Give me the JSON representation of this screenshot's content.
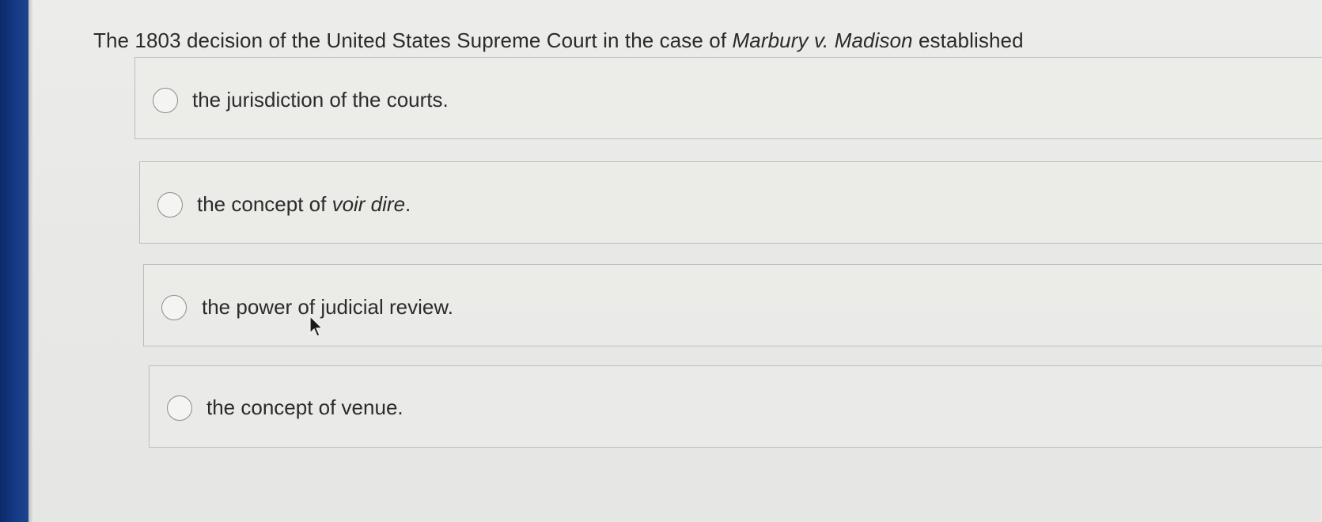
{
  "question": {
    "prefix": "The 1803 decision of the United States Supreme Court in the case of ",
    "case_name": "Marbury v. Madison",
    "suffix": " established"
  },
  "options": [
    {
      "text": "the jurisdiction of the courts."
    },
    {
      "prefix": "the concept of ",
      "italic": "voir dire",
      "suffix": "."
    },
    {
      "text": "the power of judicial review."
    },
    {
      "text": "the concept of venue."
    }
  ],
  "selected_option": null,
  "icons": {
    "radio": "radio-button-empty-icon",
    "pointer": "mouse-pointer-icon"
  },
  "colors": {
    "text": "#2b2b2b",
    "border": "#bdbdbb",
    "radio_border": "#8d8d8b",
    "bezel": "#163a86"
  }
}
